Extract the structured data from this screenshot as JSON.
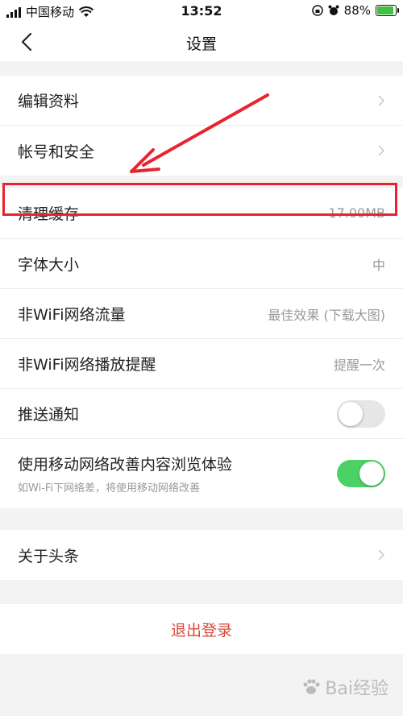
{
  "status_bar": {
    "carrier": "中国移动",
    "time": "13:52",
    "battery_percent": "88%",
    "battery_level": 0.88
  },
  "nav": {
    "title": "设置"
  },
  "group1": [
    {
      "label": "编辑资料"
    },
    {
      "label": "帐号和安全"
    }
  ],
  "group2": {
    "clear_cache": {
      "label": "清理缓存",
      "value": "17.00MB"
    },
    "font_size": {
      "label": "字体大小",
      "value": "中"
    },
    "non_wifi_traffic": {
      "label": "非WiFi网络流量",
      "value": "最佳效果 (下载大图)"
    },
    "non_wifi_play": {
      "label": "非WiFi网络播放提醒",
      "value": "提醒一次"
    },
    "push": {
      "label": "推送通知",
      "enabled": false
    },
    "mobile_improve": {
      "label": "使用移动网络改善内容浏览体验",
      "sublabel": "如Wi-Fi下网络差，将使用移动网络改善",
      "enabled": true
    }
  },
  "group3": [
    {
      "label": "关于头条"
    }
  ],
  "logout_label": "退出登录",
  "watermark": "Bai经验",
  "colors": {
    "accent_red": "#e8232f",
    "toggle_on": "#4cd264",
    "toggle_off": "#e6e6e6",
    "logout": "#d94b3a"
  }
}
